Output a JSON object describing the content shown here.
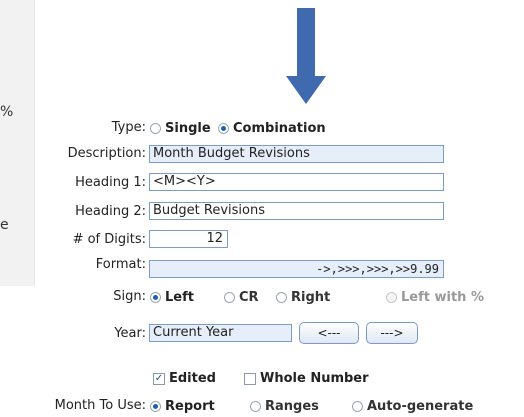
{
  "background_fragments": {
    "frag1": "%",
    "frag2": "e"
  },
  "form": {
    "type": {
      "label": "Type:",
      "options": [
        "Single",
        "Combination"
      ],
      "selected": "Combination"
    },
    "description": {
      "label": "Description:",
      "value": "Month Budget Revisions"
    },
    "heading1": {
      "label": "Heading 1:",
      "value": "<M><Y>"
    },
    "heading2": {
      "label": "Heading 2:",
      "value": "Budget Revisions"
    },
    "digits": {
      "label": "# of Digits:",
      "value": "12"
    },
    "format": {
      "label": "Format:",
      "value": "->,>>>,>>>,>>9.99"
    },
    "sign": {
      "label": "Sign:",
      "options": [
        "Left",
        "CR",
        "Right",
        "Left with %"
      ],
      "selected": "Left"
    },
    "year": {
      "label": "Year:",
      "value": "Current Year",
      "prev_label": "<---",
      "next_label": "--->"
    },
    "checks": {
      "edited": {
        "label": "Edited",
        "checked": true
      },
      "whole_number": {
        "label": "Whole Number",
        "checked": false
      }
    },
    "month_to_use": {
      "label": "Month To Use:",
      "options": [
        "Report",
        "Ranges",
        "Auto-generate"
      ],
      "selected": "Report"
    }
  },
  "colors": {
    "arrow": "#3f6ab0",
    "field_fill": "#e6eefa",
    "field_border": "#7a9cc6"
  }
}
